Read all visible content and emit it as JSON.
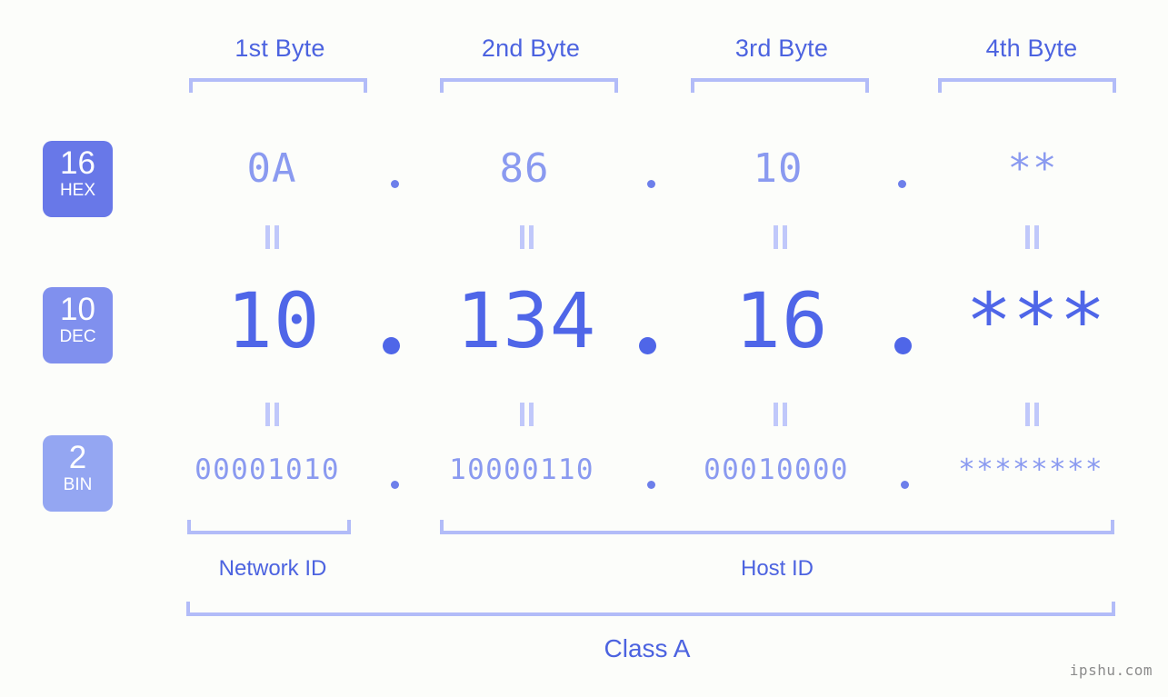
{
  "background_color": "#fcfdfa",
  "accent_color": "#4f66e8",
  "accent_light_color": "#8a9af0",
  "bracket_color": "#b2bcf8",
  "byte_headers": [
    {
      "label": "1st Byte"
    },
    {
      "label": "2nd Byte"
    },
    {
      "label": "3rd Byte"
    },
    {
      "label": "4th Byte"
    }
  ],
  "radix_badges": [
    {
      "number": "16",
      "system": "HEX",
      "color": "#6878e8"
    },
    {
      "number": "10",
      "system": "DEC",
      "color": "#8090ee"
    },
    {
      "number": "2",
      "system": "BIN",
      "color": "#94a6f2"
    }
  ],
  "rows": {
    "hex": {
      "b1": "0A",
      "b2": "86",
      "b3": "10",
      "b4": "**"
    },
    "dec": {
      "b1": "10",
      "b2": "134",
      "b3": "16",
      "b4": "***"
    },
    "bin": {
      "b1": "00001010",
      "b2": "10000110",
      "b3": "00010000",
      "b4": "********"
    }
  },
  "separator": ".",
  "equals_sign": "=",
  "sections": {
    "network_id": "Network ID",
    "host_id": "Host ID",
    "class": "Class A"
  },
  "watermark": "ipshu.com"
}
